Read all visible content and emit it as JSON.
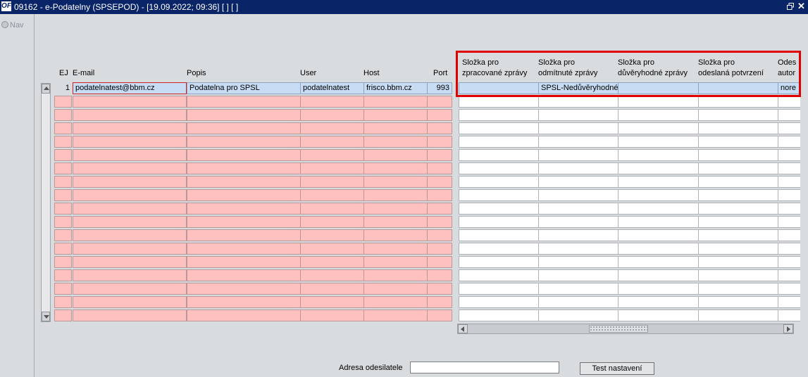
{
  "window": {
    "title": "09162 - e-Podatelny (SPSEPOD) - [19.09.2022; 09:36]  [ ]  [ ]",
    "app_icon": "OF"
  },
  "nav": {
    "label": "Nav"
  },
  "columns": {
    "ej": "EJ",
    "email": "E-mail",
    "popis": "Popis",
    "user": "User",
    "host": "Host",
    "port": "Port",
    "zpracovane": [
      "Složka pro",
      "zpracované zprávy"
    ],
    "odmitnute": [
      "Složka pro",
      "odmítnuté zprávy"
    ],
    "duveryhodne": [
      "Složka pro",
      "důvěryhodné zprávy"
    ],
    "potvrzeni": [
      "Složka pro",
      "odeslaná potvrzení"
    ],
    "odes": [
      "Odes",
      "autor"
    ]
  },
  "row1": {
    "ej": "1",
    "email": "podatelnatest@bbm.cz",
    "popis": "Podatelna pro SPSL",
    "user": "podatelnatest",
    "host": "frisco.bbm.cz",
    "port": "993",
    "zpracovane": "",
    "odmitnute": "SPSL-Nedůvěryhodné",
    "duveryhodne": "",
    "potvrzeni": "",
    "odes": "nore"
  },
  "footer": {
    "adresa_label": "Adresa odesilatele",
    "adresa_value": "",
    "test_button": "Test nastavení"
  },
  "colors": {
    "required_field": "#ffc0c0",
    "current_row": "#c8dcf4",
    "highlight": "#e00000",
    "titlebar": "#0a2468"
  }
}
